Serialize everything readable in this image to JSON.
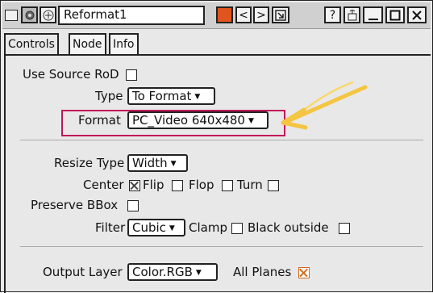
{
  "window": {
    "title": "Reformat1",
    "buttons": {
      "prev": "<",
      "next": ">",
      "collapse": "⬃",
      "help": "?",
      "float": "⌂",
      "minimize": "_",
      "maximize": "□",
      "close": "×"
    },
    "color_swatch": "#e0551f"
  },
  "tabs": [
    {
      "label": "Controls"
    },
    {
      "label": "Node"
    },
    {
      "label": "Info"
    }
  ],
  "controls": {
    "use_source_rod_label": "Use Source RoD",
    "type_label": "Type",
    "type_value": "To Format",
    "format_label": "Format",
    "format_value": "PC_Video 640x480",
    "resize_type_label": "Resize Type",
    "resize_type_value": "Width",
    "center_label": "Center",
    "flip_label": "Flip",
    "flop_label": "Flop",
    "turn_label": "Turn",
    "preserve_bbox_label": "Preserve BBox",
    "filter_label": "Filter",
    "filter_value": "Cubic",
    "clamp_label": "Clamp",
    "black_outside_label": "Black outside",
    "output_layer_label": "Output Layer",
    "output_layer_value": "Color.RGB",
    "all_planes_label": "All Planes",
    "checks": {
      "use_source_rod": false,
      "center": true,
      "flip": false,
      "flop": false,
      "turn": false,
      "preserve_bbox": false,
      "clamp": false,
      "black_outside": false,
      "all_planes": true
    }
  },
  "colors": {
    "highlight_box": "#c0185a",
    "arrow": "#f4c542",
    "all_planes_check": "#d2691e"
  }
}
